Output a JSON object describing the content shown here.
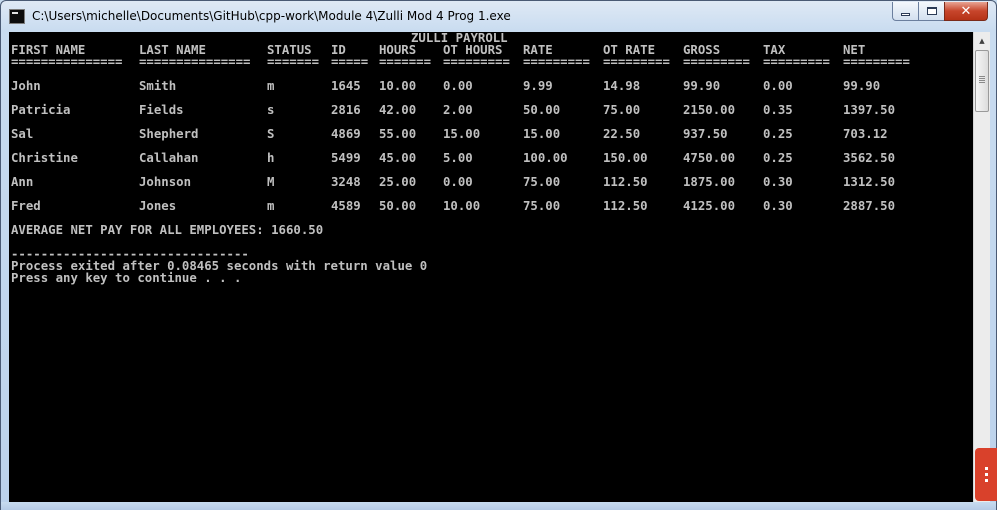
{
  "window": {
    "title": "C:\\Users\\michelle\\Documents\\GitHub\\cpp-work\\Module 4\\Zulli Mod 4 Prog 1.exe",
    "controls": {
      "minimize": "minimize",
      "maximize": "maximize",
      "close": "✕"
    }
  },
  "console": {
    "report_title": "ZULLI PAYROLL",
    "headers": [
      "FIRST NAME",
      "LAST NAME",
      "STATUS",
      "ID",
      "HOURS",
      "OT HOURS",
      "RATE",
      "OT RATE",
      "GROSS",
      "TAX",
      "NET"
    ],
    "separators": [
      "===============",
      "===============",
      "=======",
      "=====",
      "=======",
      "=========",
      "=========",
      "=========",
      "=========",
      "=========",
      "========="
    ],
    "rows": [
      [
        "John",
        "Smith",
        "m",
        "1645",
        "10.00",
        "0.00",
        "9.99",
        "14.98",
        "99.90",
        "0.00",
        "99.90"
      ],
      [
        "Patricia",
        "Fields",
        "s",
        "2816",
        "42.00",
        "2.00",
        "50.00",
        "75.00",
        "2150.00",
        "0.35",
        "1397.50"
      ],
      [
        "Sal",
        "Shepherd",
        "S",
        "4869",
        "55.00",
        "15.00",
        "15.00",
        "22.50",
        "937.50",
        "0.25",
        "703.12"
      ],
      [
        "Christine",
        "Callahan",
        "h",
        "5499",
        "45.00",
        "5.00",
        "100.00",
        "150.00",
        "4750.00",
        "0.25",
        "3562.50"
      ],
      [
        "Ann",
        "Johnson",
        "M",
        "3248",
        "25.00",
        "0.00",
        "75.00",
        "112.50",
        "1875.00",
        "0.30",
        "1312.50"
      ],
      [
        "Fred",
        "Jones",
        "m",
        "4589",
        "50.00",
        "10.00",
        "75.00",
        "112.50",
        "4125.00",
        "0.30",
        "2887.50"
      ]
    ],
    "average_line": "AVERAGE NET PAY FOR ALL EMPLOYEES: 1660.50",
    "divider": "--------------------------------",
    "exit_line": "Process exited after 0.08465 seconds with return value 0",
    "prompt_line": "Press any key to continue . . ."
  },
  "scrollbar": {
    "up_arrow": "▲",
    "down_arrow": "▼"
  },
  "colors": {
    "console_bg": "#000000",
    "console_text": "#c0c0c0",
    "side_tab": "#d9412b"
  }
}
